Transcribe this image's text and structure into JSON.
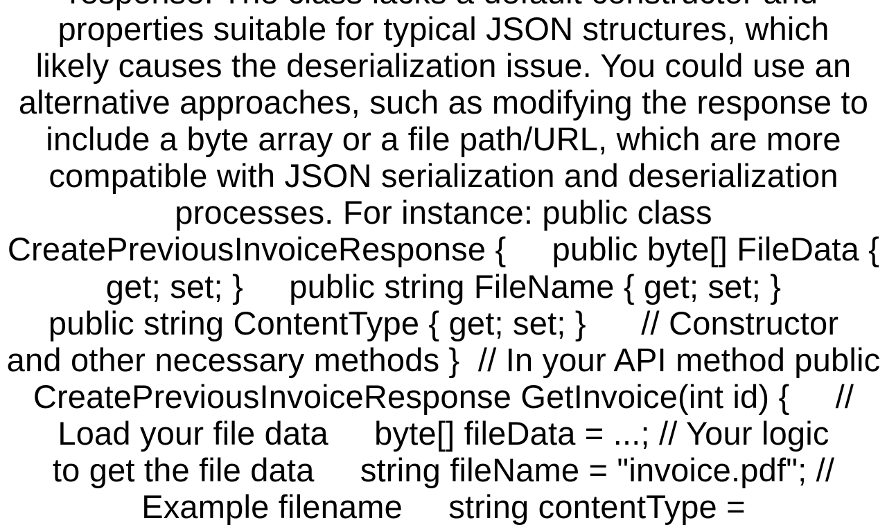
{
  "document": {
    "body": "response. The class lacks a default constructor and\nproperties suitable for typical JSON structures, which\nlikely causes the deserialization issue. You could use an\nalternative approaches, such as modifying the response to\ninclude a byte array or a file path/URL, which are more\ncompatible with JSON serialization and deserialization\nprocesses. For instance: public class\nCreatePreviousInvoiceResponse {     public byte[] FileData {\nget; set; }     public string FileName { get; set; }\npublic string ContentType { get; set; }      // Constructor\nand other necessary methods }  // In your API method public\nCreatePreviousInvoiceResponse GetInvoice(int id) {     //\nLoad your file data     byte[] fileData = ...; // Your logic\nto get the file data     string fileName = \"invoice.pdf\"; //\nExample filename     string contentType ="
  }
}
